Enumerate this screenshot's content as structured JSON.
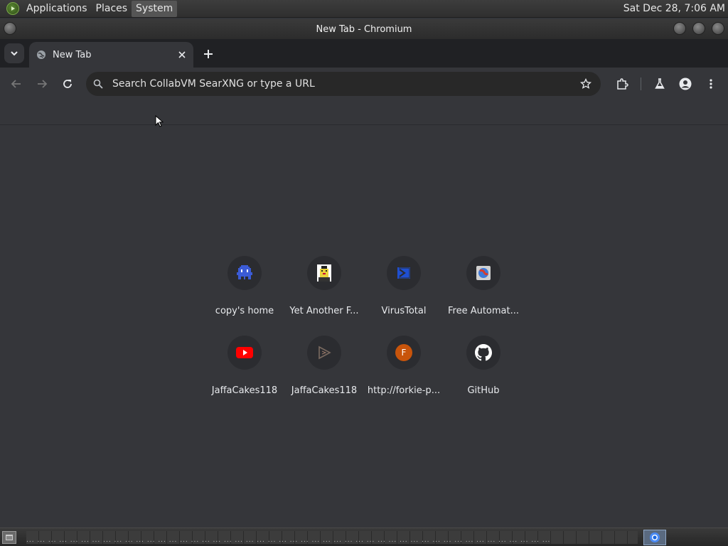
{
  "desktop_panel": {
    "menus": [
      "Applications",
      "Places",
      "System"
    ],
    "clock": "Sat Dec 28,  7:06 AM"
  },
  "window": {
    "title": "New Tab - Chromium"
  },
  "tabs": [
    {
      "title": "New Tab"
    }
  ],
  "omnibox": {
    "placeholder": "Search CollabVM SearXNG or type a URL"
  },
  "shortcuts": [
    {
      "label": "copy's home",
      "icon": "pixel-monster-icon",
      "color": "#3b5bd6"
    },
    {
      "label": "Yet Another F...",
      "icon": "pixel-character-icon",
      "color": "#e8d23a"
    },
    {
      "label": "VirusTotal",
      "icon": "virustotal-icon",
      "color": "#1f4fd1"
    },
    {
      "label": "Free Automat...",
      "icon": "globe-favicon-icon",
      "color": "#d93b2b"
    },
    {
      "label": "JaffaCakes118",
      "icon": "youtube-icon",
      "color": "#ff0000"
    },
    {
      "label": "JaffaCakes118",
      "icon": "play-triangle-icon",
      "color": "#7a6a60"
    },
    {
      "label": "http://forkie-p...",
      "icon": "letter-avatar-icon",
      "color": "#c8540b",
      "letter": "F"
    },
    {
      "label": "GitHub",
      "icon": "github-icon",
      "color": "#ffffff"
    }
  ],
  "taskbar": {
    "filler": "... ... ... ... ... ... ... ... ... ... ... ... ... ... ... ... ... ... ... ... ... ... ... ... ... ... ... ... ... ... ... ... ... ... ... ... ... ... ... ... ... ... ... ... ... ... ... ..."
  }
}
